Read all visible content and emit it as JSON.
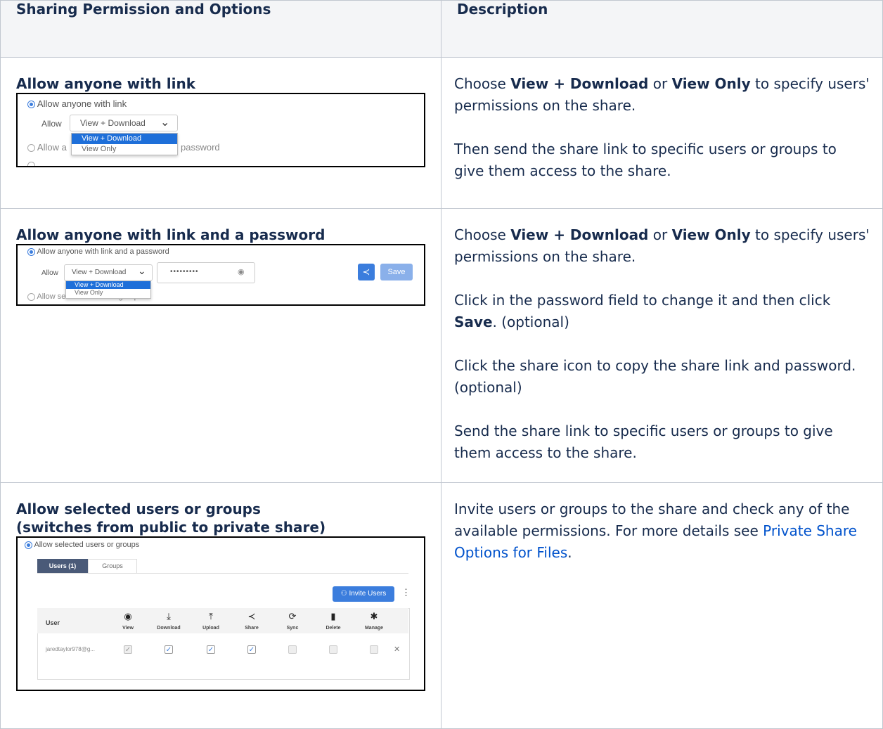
{
  "header": {
    "col1": "Sharing Permission and Options",
    "col2": "Description"
  },
  "rows": [
    {
      "title": "Allow anyone with link",
      "shot": {
        "radio1": "Allow anyone with link",
        "allow_label": "Allow",
        "select_value": "View + Download",
        "options": [
          "View + Download",
          "View Only"
        ],
        "radio2_a": "Allow a",
        "radio2_b": "password"
      },
      "desc": {
        "p1_a": "Choose ",
        "p1_b1": "View + Download",
        "p1_c": " or ",
        "p1_b2": "View Only",
        "p1_d": " to specify users' permissions on the share.",
        "p2": "Then send the share link to specific users or groups to give them access to the share."
      }
    },
    {
      "title": "Allow anyone with link and a password",
      "shot": {
        "radio1": "Allow anyone with link and a password",
        "allow_label": "Allow",
        "select_value": "View + Download",
        "password_mask": "•••••••••",
        "options": [
          "View + Download",
          "View Only"
        ],
        "save_label": "Save",
        "radio2": "Allow selected users or groups"
      },
      "desc": {
        "p1_a": "Choose ",
        "p1_b1": "View + Download",
        "p1_c": " or ",
        "p1_b2": "View Only",
        "p1_d": " to specify users' permissions on the share.",
        "p2_a": "Click in the password field to change it and then click ",
        "p2_b": "Save",
        "p2_c": ". (optional)",
        "p3": "Click the share icon to copy the share link and password. (optional)",
        "p4": "Send the share link to specific users or groups to give them access to the share."
      }
    },
    {
      "title_line1": "Allow selected users or groups",
      "title_line2": "(switches from public to private share)",
      "shot": {
        "radio1": "Allow selected users or groups",
        "tab_users": "Users (1)",
        "tab_groups": "Groups",
        "invite_label": "Invite Users",
        "col_user": "User",
        "perm_cols": [
          "View",
          "Download",
          "Upload",
          "Share",
          "Sync",
          "Delete",
          "Manage"
        ],
        "user_email": "jaredtaylor978@g...",
        "checks": [
          true,
          true,
          true,
          true,
          false,
          false,
          false
        ]
      },
      "desc": {
        "p1_a": "Invite users or groups to the share and check any of the available permissions. For more details see ",
        "p1_link": "Private Share Options for Files",
        "p1_b": "."
      }
    }
  ],
  "colors": {
    "header_bg": "#f4f5f7",
    "border": "#c1c7d0",
    "link": "#0052cc",
    "accent": "#1e6fd9"
  }
}
